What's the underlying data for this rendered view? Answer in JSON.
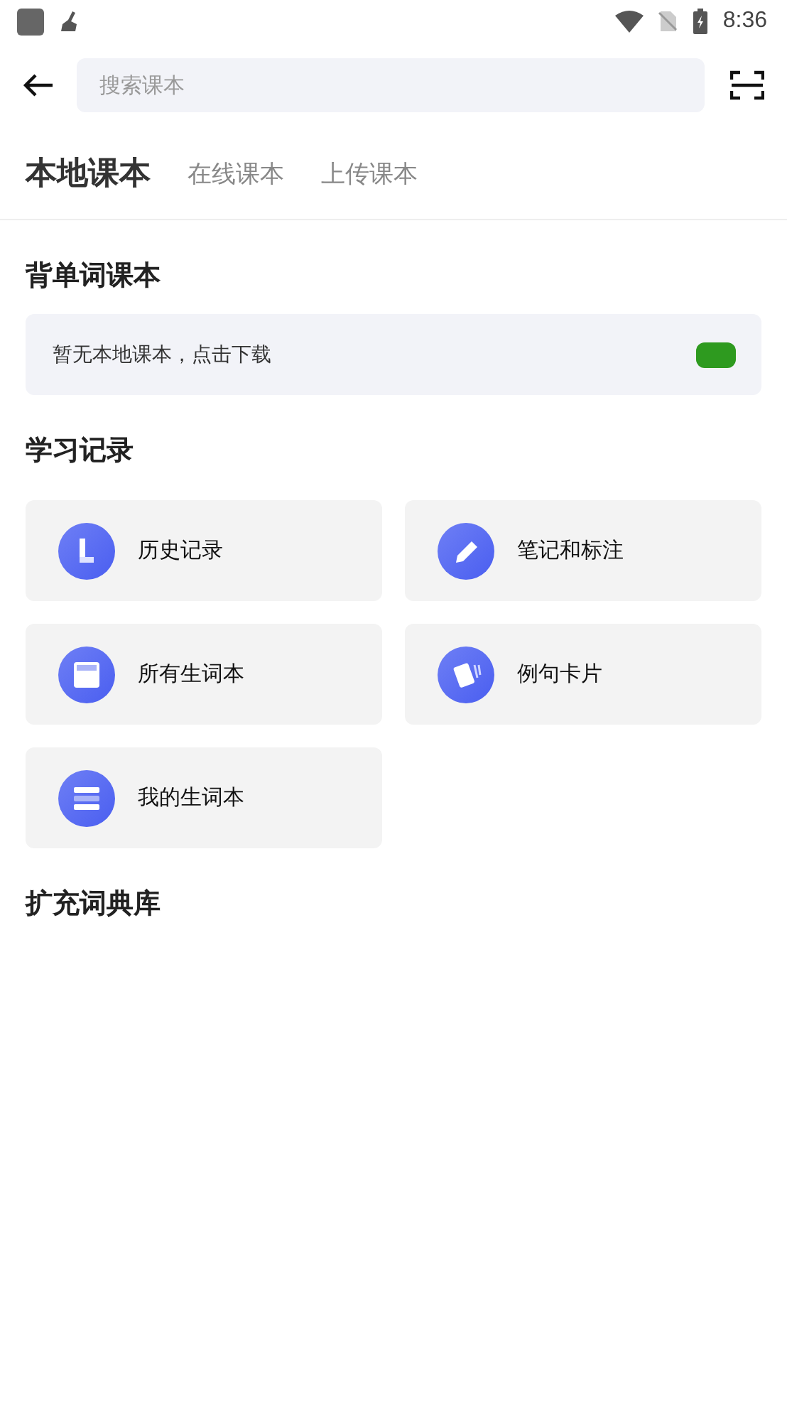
{
  "status_bar": {
    "time": "8:36"
  },
  "search": {
    "placeholder": "搜索课本"
  },
  "tabs": [
    {
      "label": "本地课本",
      "selected": true
    },
    {
      "label": "在线课本",
      "selected": false
    },
    {
      "label": "上传课本",
      "selected": false
    }
  ],
  "sections": [
    {
      "title": "背单词课本",
      "empty_message": "暂无本地课本，点击下载"
    },
    {
      "title": "学习记录",
      "items": [
        {
          "label": "历史记录"
        },
        {
          "label": "笔记和标注"
        },
        {
          "label": "所有生词本"
        },
        {
          "label": "例句卡片"
        },
        {
          "label": "我的生词本"
        }
      ]
    },
    {
      "title": "扩充词典库"
    }
  ]
}
